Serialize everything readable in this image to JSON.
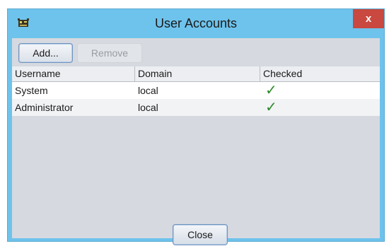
{
  "window": {
    "title": "User Accounts",
    "close_glyph": "x",
    "app_icon": "app-icon"
  },
  "toolbar": {
    "add_label": "Add...",
    "remove_label": "Remove",
    "remove_enabled": false
  },
  "table": {
    "columns": [
      "Username",
      "Domain",
      "Checked"
    ],
    "rows": [
      {
        "username": "System",
        "domain": "local",
        "checked": true,
        "check_glyph": "✓"
      },
      {
        "username": "Administrator",
        "domain": "local",
        "checked": true,
        "check_glyph": "✓"
      }
    ]
  },
  "footer": {
    "close_label": "Close"
  },
  "colors": {
    "titlebar": "#6ec3ec",
    "close_button": "#c9483f",
    "client_bg": "#d6d9df",
    "row_selected_bg": "#ffffff",
    "check_green": "#2a8a2a"
  }
}
